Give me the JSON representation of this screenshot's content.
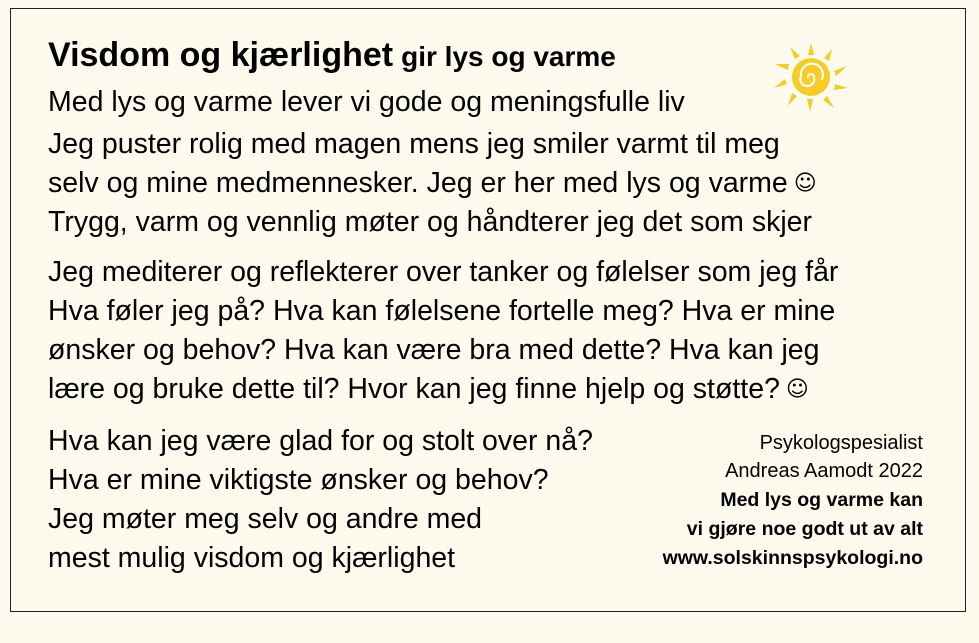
{
  "heading": {
    "title": "Visdom og kjærlighet",
    "subtitle": "gir lys og varme"
  },
  "icons": {
    "sun": "sun-icon",
    "smiley": "smiley-icon",
    "sun_color": "#f5cc2a"
  },
  "intro": "Med lys og varme lever vi gode og meningsfulle liv",
  "paragraph1": [
    "Jeg puster rolig med magen mens jeg smiler varmt til meg",
    "selv og mine medmennesker. Jeg er her med lys og varme",
    "Trygg, varm og vennlig møter og håndterer jeg det som skjer"
  ],
  "paragraph2": [
    "Jeg mediterer og reflekterer over tanker og følelser som jeg får",
    "Hva føler jeg på? Hva kan følelsene fortelle meg? Hva er mine",
    "ønsker og behov? Hva kan være bra med dette? Hva kan jeg",
    "lære og bruke dette til? Hvor kan jeg finne hjelp og støtte?"
  ],
  "smiley_glyph": "☺",
  "paragraph3": [
    "Hva kan jeg være glad for og stolt over nå?",
    "Hva er mine viktigste ønsker og behov?",
    "Jeg møter meg selv og andre med",
    "mest mulig visdom og kjærlighet"
  ],
  "signature": {
    "role": "Psykologspesialist",
    "author": "Andreas Aamodt 2022",
    "motto_line1": "Med lys og varme kan",
    "motto_line2": "vi gjøre noe godt ut av alt",
    "website": "www.solskinnspsykologi.no"
  }
}
